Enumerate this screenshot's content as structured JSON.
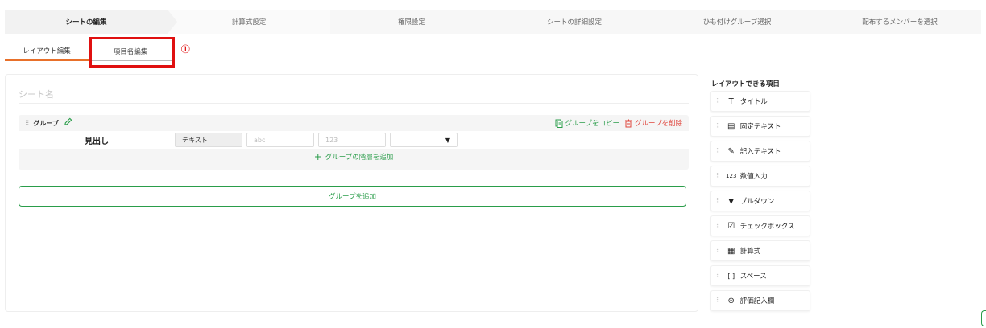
{
  "steps": [
    "シートの編集",
    "計算式設定",
    "権限設定",
    "シートの詳細設定",
    "ひも付けグループ選択",
    "配布するメンバーを選択"
  ],
  "subtabs": {
    "layout": "レイアウト編集",
    "item_names": "項目名編集"
  },
  "annotation": "①",
  "sheet_name_placeholder": "シート名",
  "group": {
    "drag": "⁝⁝",
    "title": "グループ",
    "copy": "グループをコピー",
    "delete": "グループを削除",
    "row_label": "見出し",
    "fields": {
      "text": "テキスト",
      "abc": "abc",
      "num": "123",
      "select_arrow": "▼"
    },
    "add_level": "グループの階層を追加"
  },
  "add_group": "グループを追加",
  "palette": {
    "title": "レイアウトできる項目",
    "items": [
      {
        "icon": "T",
        "label": "タイトル"
      },
      {
        "icon": "▤",
        "label": "固定テキスト"
      },
      {
        "icon": "✎",
        "label": "記入テキスト"
      },
      {
        "icon": "123",
        "label": "数値入力"
      },
      {
        "icon": "▼",
        "label": "プルダウン"
      },
      {
        "icon": "☑",
        "label": "チェックボックス"
      },
      {
        "icon": "▦",
        "label": "計算式"
      },
      {
        "icon": "[ ]",
        "label": "スペース"
      },
      {
        "icon": "⊛",
        "label": "評価記入欄"
      }
    ]
  },
  "colors": {
    "accent_green": "#2a9d4a",
    "delete_red": "#e0453c",
    "tab_underline": "#e8702a",
    "highlight_box": "#e01010"
  }
}
